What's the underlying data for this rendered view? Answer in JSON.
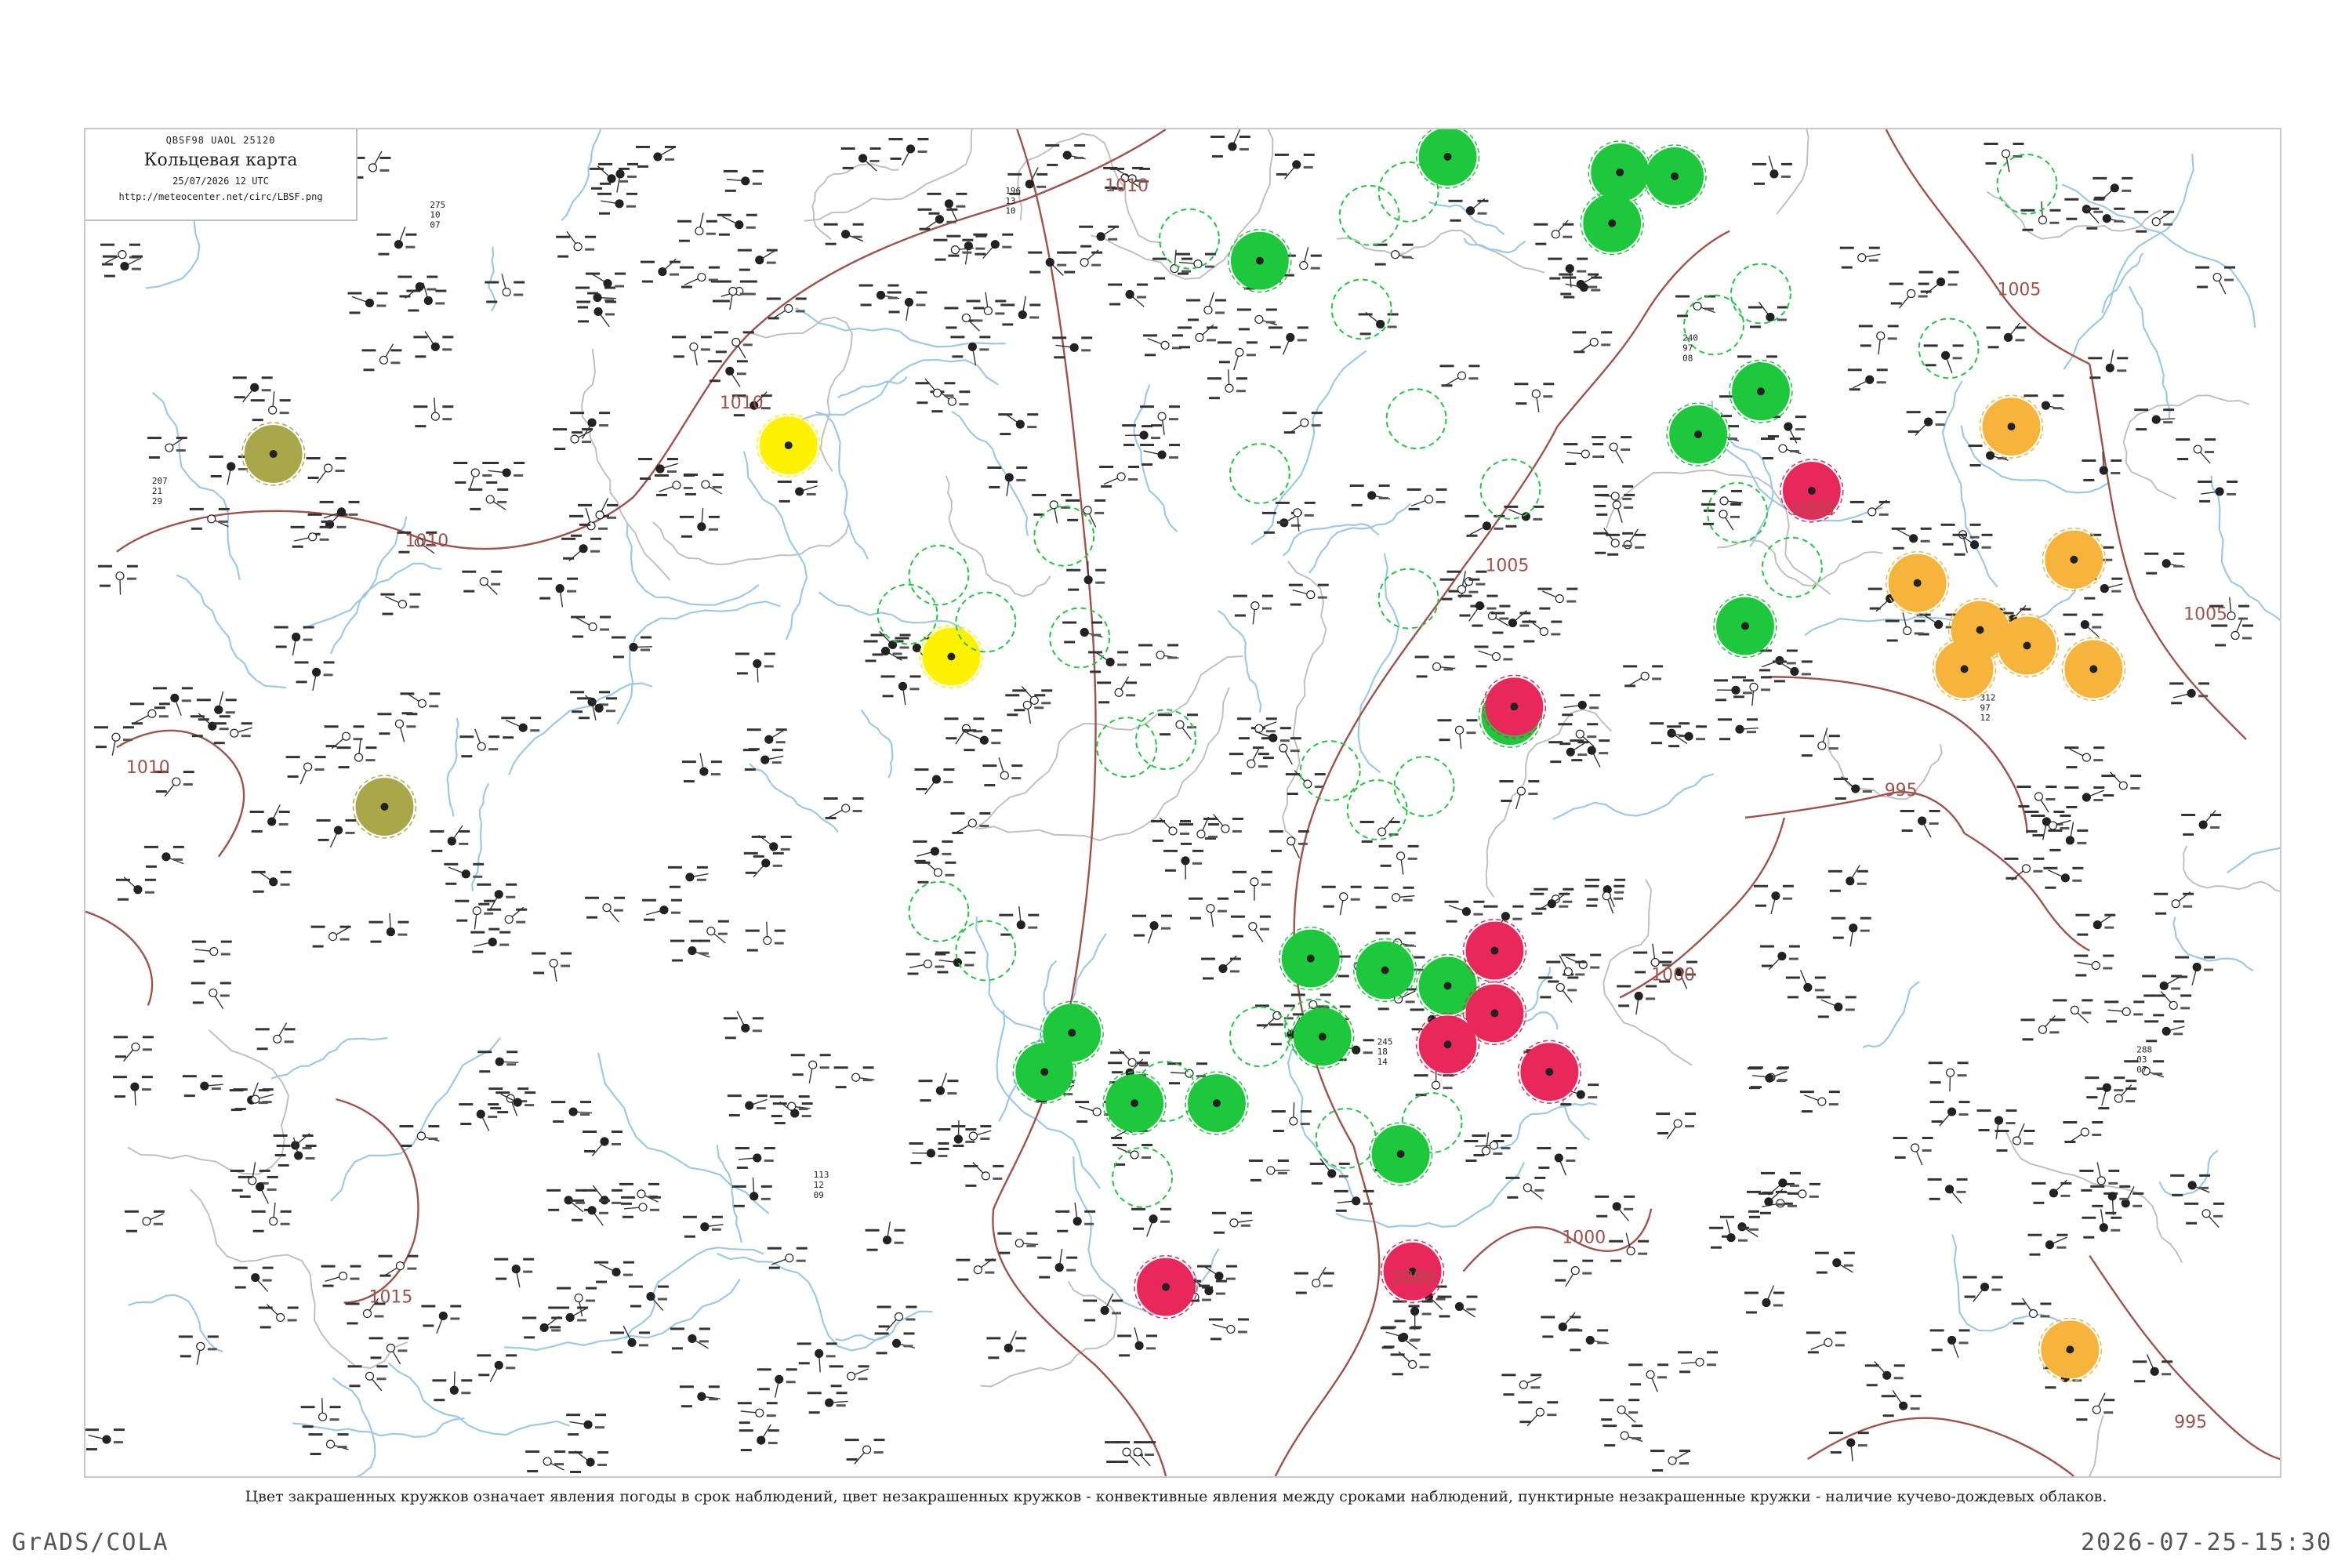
{
  "header": {
    "code": "QBSF98  UAOL  25120",
    "title": "Кольцевая карта",
    "date": "25/07/2026 12 UTC",
    "url": "http://meteocenter.net/circ/LBSF.png"
  },
  "caption": "Цвет закрашенных кружков означает явления погоды в срок наблюдений, цвет незакрашенных кружков - конвективные явления между сроками наблюдений, пунктирные незакрашенные кружки - наличие кучево-дождевых облаков.",
  "footer": {
    "left": "GrADS/COLA",
    "right": "2026-07-25-15:30"
  },
  "colors": {
    "isobar": "#a0524a",
    "river": "#9cc8ea",
    "border": "#c0c0c0",
    "rain": "#1ec83c",
    "thunder": "#e8285a",
    "shower": "#f7b43c",
    "fog": "#fff200",
    "haze": "#a8a84a"
  },
  "isobars": [
    {
      "label": "1010"
    },
    {
      "label": "1010"
    },
    {
      "label": "1010"
    },
    {
      "label": "1010"
    },
    {
      "label": "1015"
    },
    {
      "label": "1005"
    },
    {
      "label": "1005"
    },
    {
      "label": "1005"
    },
    {
      "label": "1000"
    },
    {
      "label": "1000"
    },
    {
      "label": "1000"
    },
    {
      "label": "1000"
    },
    {
      "label": "995"
    },
    {
      "label": "995"
    }
  ],
  "stations": [
    {
      "p": "207",
      "t": "21",
      "td": "29"
    },
    {
      "p": "275",
      "t": "10",
      "td": "07"
    },
    {
      "p": "196",
      "t": "13",
      "td": "10"
    },
    {
      "p": "245",
      "t": "18",
      "td": "14"
    },
    {
      "p": "312",
      "t": "97",
      "td": "12"
    },
    {
      "p": "288",
      "t": "03",
      "td": "07"
    },
    {
      "p": "113",
      "t": "12",
      "td": "09"
    },
    {
      "p": "240",
      "t": "97",
      "td": "08"
    }
  ]
}
